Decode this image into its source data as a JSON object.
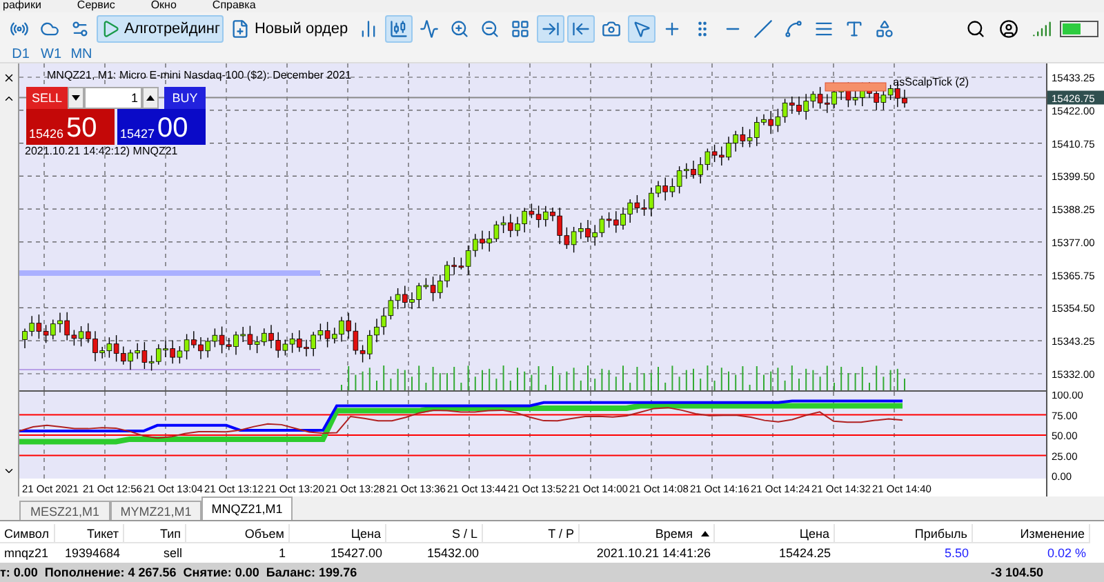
{
  "menu": [
    "рафики",
    "Сервис",
    "Окно",
    "Справка"
  ],
  "toolbar": [
    {
      "kind": "icon",
      "selected": false
    },
    {
      "kind": "icon",
      "selected": false
    },
    {
      "kind": "icon",
      "selected": false
    },
    {
      "kind": "button",
      "label": "Алготрейдинг",
      "selected": true
    },
    {
      "kind": "button",
      "label": "Новый ордер",
      "selected": false
    },
    {
      "kind": "icon",
      "selected": false
    },
    {
      "kind": "icon",
      "selected": true
    },
    {
      "kind": "icon",
      "selected": false
    },
    {
      "kind": "icon",
      "selected": false
    },
    {
      "kind": "icon",
      "selected": false
    },
    {
      "kind": "icon",
      "selected": false
    },
    {
      "kind": "icon",
      "selected": true
    },
    {
      "kind": "icon",
      "selected": true
    },
    {
      "kind": "icon",
      "selected": false
    },
    {
      "kind": "icon",
      "selected": true
    },
    {
      "kind": "icon",
      "selected": false
    },
    {
      "kind": "icon",
      "selected": false
    },
    {
      "kind": "icon",
      "selected": false
    },
    {
      "kind": "icon",
      "selected": false
    },
    {
      "kind": "icon",
      "selected": false
    },
    {
      "kind": "icon",
      "selected": false
    },
    {
      "kind": "icon",
      "selected": false
    },
    {
      "kind": "icon",
      "selected": false
    }
  ],
  "timeframes": [
    {
      "label": "D1",
      "selected": false
    },
    {
      "label": "W1",
      "selected": false
    },
    {
      "label": "MN",
      "selected": false
    }
  ],
  "chart": {
    "title": "MNQZ21, M1:  Micro E-mini Nasdaq-100 ($2): December 2021",
    "indicator_label": "asScalpTick (2)",
    "timestamp": "2021.10.21 14:42:12) MNQZ21",
    "current_price": "15426.75",
    "price_ticks": [
      "15433.25",
      "15422.00",
      "15410.75",
      "15399.50",
      "15388.25",
      "15377.00",
      "15365.75",
      "15354.50",
      "15343.25",
      "15332.00"
    ],
    "oscillator_ticks": [
      "100.00",
      "75.00",
      "50.00",
      "25.00",
      "0.00"
    ],
    "time_ticks": [
      "21 Oct 2021",
      "21 Oct 12:56",
      "21 Oct 13:04",
      "21 Oct 13:12",
      "21 Oct 13:20",
      "21 Oct 13:28",
      "21 Oct 13:36",
      "21 Oct 13:44",
      "21 Oct 13:52",
      "21 Oct 14:00",
      "21 Oct 14:08",
      "21 Oct 14:16",
      "21 Oct 14:24",
      "21 Oct 14:32",
      "21 Oct 14:40"
    ]
  },
  "trade_panel": {
    "sell_label": "SELL",
    "buy_label": "BUY",
    "volume": "1",
    "sell_big": "15426",
    "sell_small": "50",
    "buy_big": "15427",
    "buy_small": "00"
  },
  "chart_tabs": [
    {
      "label": "MESZ21,M1",
      "selected": false
    },
    {
      "label": "MYMZ21,M1",
      "selected": false
    },
    {
      "label": "MNQZ21,M1",
      "selected": true
    }
  ],
  "table": {
    "columns": [
      "Символ",
      "Тикет",
      "Тип",
      "Объем",
      "Цена",
      "S / L",
      "T / P",
      "Время",
      "Цена",
      "Прибыль",
      "Изменение"
    ],
    "rows": [
      [
        "mnqz21",
        "19394684",
        "sell",
        "1",
        "15427.00",
        "15432.00",
        "",
        "2021.10.21 14:41:26",
        "15424.25",
        "5.50",
        "0.02 %"
      ]
    ]
  },
  "status_bar": {
    "summary": "т: 0.00  Пополнение: 4 267.56  Снятие: 0.00  Баланс: 199.76",
    "total": "-3 104.50"
  }
}
